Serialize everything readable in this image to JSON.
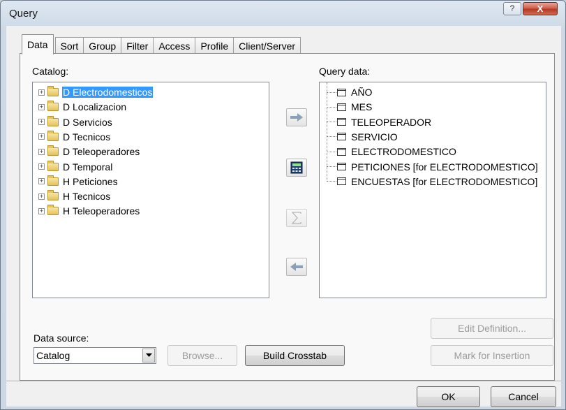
{
  "window": {
    "title": "Query",
    "help_label": "?",
    "close_label": "X"
  },
  "tabs": [
    {
      "label": "Data",
      "active": true
    },
    {
      "label": "Sort",
      "active": false
    },
    {
      "label": "Group",
      "active": false
    },
    {
      "label": "Filter",
      "active": false
    },
    {
      "label": "Access",
      "active": false
    },
    {
      "label": "Profile",
      "active": false
    },
    {
      "label": "Client/Server",
      "active": false
    }
  ],
  "catalog": {
    "label": "Catalog:",
    "items": [
      {
        "label": "D Electrodomesticos",
        "selected": true
      },
      {
        "label": "D Localizacion",
        "selected": false
      },
      {
        "label": "D Servicios",
        "selected": false
      },
      {
        "label": "D Tecnicos",
        "selected": false
      },
      {
        "label": "D Teleoperadores",
        "selected": false
      },
      {
        "label": "D Temporal",
        "selected": false
      },
      {
        "label": "H Peticiones",
        "selected": false
      },
      {
        "label": "H Tecnicos",
        "selected": false
      },
      {
        "label": "H Teleoperadores",
        "selected": false
      }
    ],
    "expander_symbol": "+"
  },
  "query_data": {
    "label": "Query data:",
    "items": [
      {
        "label": "AÑO",
        "kind": "dimension"
      },
      {
        "label": "MES",
        "kind": "dimension"
      },
      {
        "label": "TELEOPERADOR",
        "kind": "dimension"
      },
      {
        "label": "SERVICIO",
        "kind": "dimension"
      },
      {
        "label": "ELECTRODOMESTICO",
        "kind": "dimension"
      },
      {
        "label": "PETICIONES [for ELECTRODOMESTICO]",
        "kind": "measure"
      },
      {
        "label": "ENCUESTAS [for ELECTRODOMESTICO]",
        "kind": "measure"
      }
    ]
  },
  "middle_buttons": {
    "add": {
      "icon": "arrow-right-icon",
      "enabled": true
    },
    "calculator": {
      "icon": "calculator-icon",
      "enabled": true
    },
    "sum": {
      "icon": "sigma-icon",
      "enabled": false
    },
    "remove": {
      "icon": "arrow-left-icon",
      "enabled": true
    }
  },
  "data_source": {
    "label": "Data source:",
    "value": "Catalog"
  },
  "buttons": {
    "browse": "Browse...",
    "build_crosstab": "Build Crosstab",
    "edit_definition": "Edit Definition...",
    "mark_for_insertion": "Mark for Insertion",
    "ok": "OK",
    "cancel": "Cancel"
  },
  "colors": {
    "selection": "#3399ff",
    "close_button": "#c9452e"
  }
}
